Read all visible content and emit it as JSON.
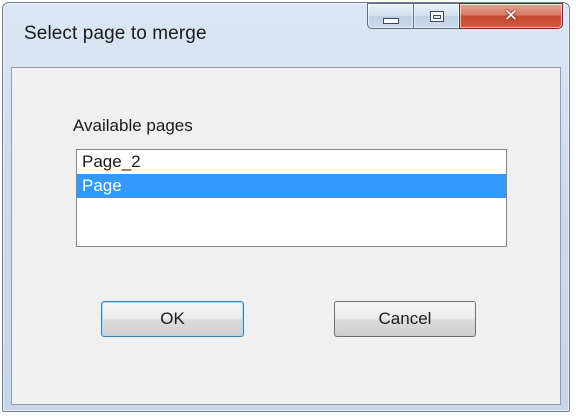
{
  "window": {
    "title": "Select page to merge",
    "controls": {
      "minimize": "minimize-icon",
      "maximize": "maximize-icon",
      "close": "close-icon"
    },
    "colors": {
      "selection": "#3399ff",
      "client_bg": "#f0f0f0",
      "close_accent": "#c44a33"
    }
  },
  "dialog": {
    "list_label": "Available pages",
    "pages": [
      "Page_2",
      "Page"
    ],
    "selected_index": 1,
    "ok_label": "OK",
    "cancel_label": "Cancel"
  }
}
